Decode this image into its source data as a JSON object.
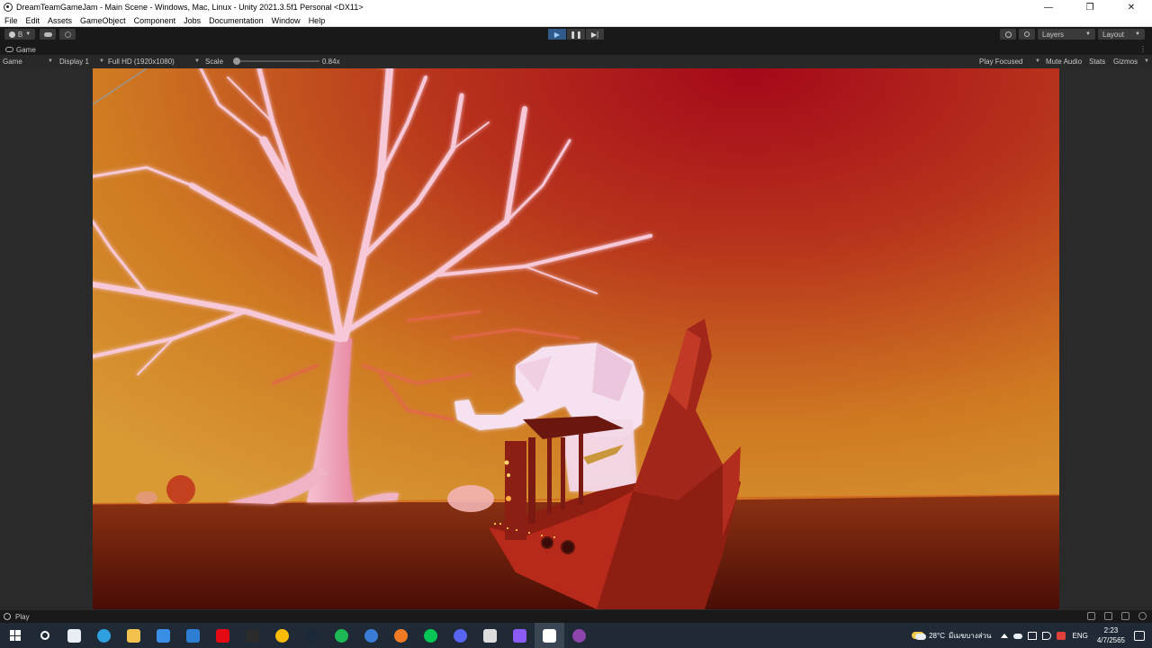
{
  "window": {
    "title": "DreamTeamGameJam - Main Scene - Windows, Mac, Linux - Unity 2021.3.5f1 Personal <DX11>",
    "controls": {
      "minimize": "—",
      "maximize": "❐",
      "close": "✕"
    }
  },
  "menu": [
    "File",
    "Edit",
    "Assets",
    "GameObject",
    "Component",
    "Jobs",
    "Documentation",
    "Window",
    "Help"
  ],
  "toolbar": {
    "account_label": "B",
    "play_icons": {
      "play": "▶",
      "pause": "❚❚",
      "step": "▶|"
    },
    "layers_label": "Layers",
    "layout_label": "Layout",
    "history_icon": "history-icon",
    "search_icon": "search-icon"
  },
  "tab": {
    "label": "Game",
    "more": "⋮"
  },
  "gamebar": {
    "mode": "Game",
    "display": "Display 1",
    "resolution": "Full HD (1920x1080)",
    "scale_label": "Scale",
    "scale_value": "0.84x",
    "scale_fraction": 0.05,
    "play_focused": "Play Focused",
    "mute_audio": "Mute Audio",
    "stats": "Stats",
    "gizmos": "Gizmos"
  },
  "status": {
    "text": "Play"
  },
  "taskbar": {
    "apps": [
      {
        "name": "windows-start",
        "color": "#ffffff"
      },
      {
        "name": "search",
        "color": "#ffffff"
      },
      {
        "name": "mail-app",
        "color": "#e8eef3"
      },
      {
        "name": "edge",
        "color": "#2fa0e0"
      },
      {
        "name": "file-explorer",
        "color": "#f2c14e"
      },
      {
        "name": "store",
        "color": "#3a8ee6"
      },
      {
        "name": "mail",
        "color": "#2d7dd2"
      },
      {
        "name": "netflix",
        "color": "#e50914"
      },
      {
        "name": "epic-games",
        "color": "#2b2b2b"
      },
      {
        "name": "chrome",
        "color": "#fbbc05"
      },
      {
        "name": "steam",
        "color": "#1b2838"
      },
      {
        "name": "spotify",
        "color": "#1db954"
      },
      {
        "name": "blue-app",
        "color": "#3a7bd5"
      },
      {
        "name": "orange-app",
        "color": "#f07b22"
      },
      {
        "name": "line",
        "color": "#06c755"
      },
      {
        "name": "discord",
        "color": "#5865f2"
      },
      {
        "name": "unity-hub",
        "color": "#dddddd"
      },
      {
        "name": "visual-studio",
        "color": "#8a5cf5"
      },
      {
        "name": "unity",
        "color": "#ffffff"
      },
      {
        "name": "github",
        "color": "#8e44ad"
      }
    ],
    "weather_temp": "28°C",
    "weather_text": "มีเมฆบางส่วน",
    "language": "ENG",
    "time": "2:23",
    "date": "4/7/2565"
  }
}
